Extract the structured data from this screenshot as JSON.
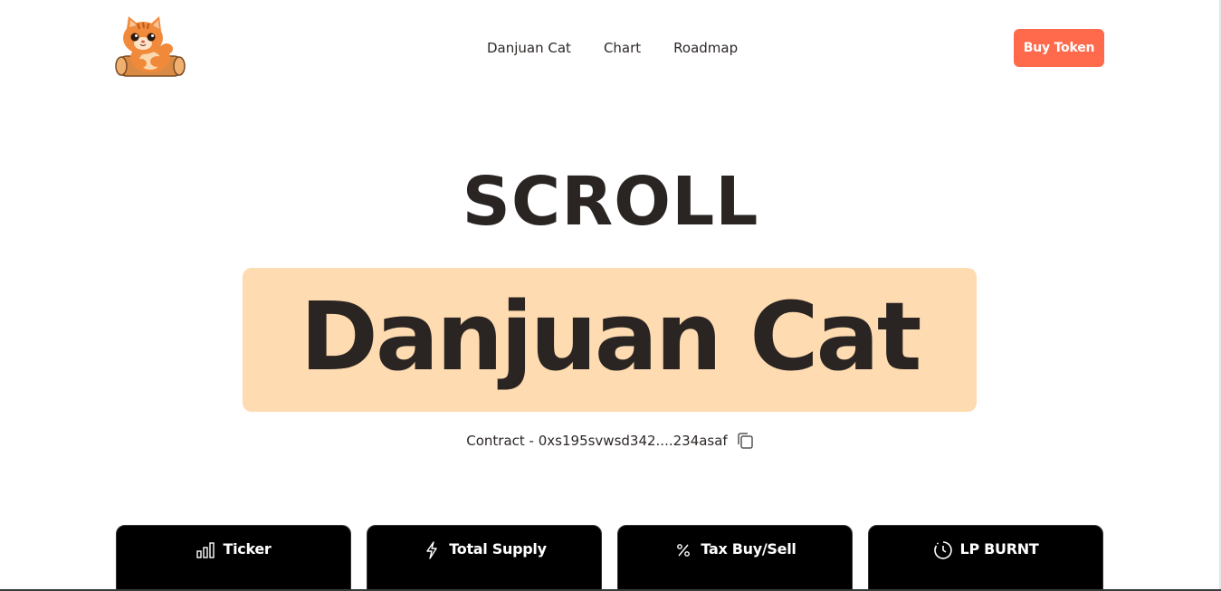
{
  "header": {
    "logo_alt": "Danjuan Cat logo",
    "nav": [
      {
        "label": "Danjuan Cat"
      },
      {
        "label": "Chart"
      },
      {
        "label": "Roadmap"
      }
    ],
    "buy_button": "Buy Token"
  },
  "hero": {
    "title": "SCROLL",
    "name": "Danjuan Cat",
    "contract_text": "Contract - 0xs195svwsd342....234asaf"
  },
  "cards": [
    {
      "label": "Ticker",
      "icon": "bar-chart-icon"
    },
    {
      "label": "Total Supply",
      "icon": "lightning-icon"
    },
    {
      "label": "Tax Buy/Sell",
      "icon": "percent-icon"
    },
    {
      "label": "LP BURNT",
      "icon": "timer-icon"
    }
  ],
  "colors": {
    "accent": "#ff6a4d",
    "highlight": "#fedbb0",
    "text": "#2a2523",
    "card_bg": "#000000"
  }
}
